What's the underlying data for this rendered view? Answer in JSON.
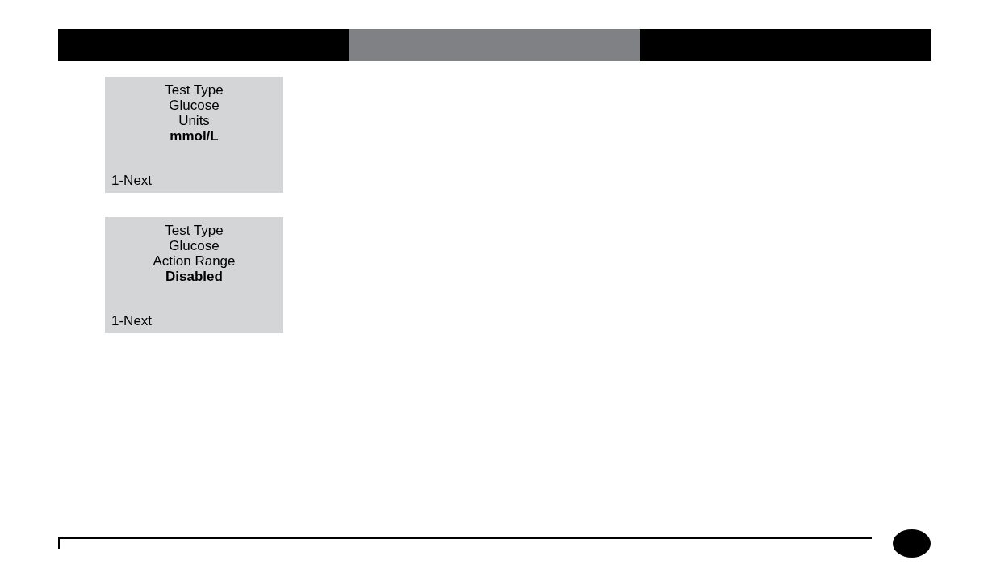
{
  "header": {
    "segments": [
      {
        "selected": false
      },
      {
        "selected": true
      },
      {
        "selected": false
      }
    ]
  },
  "screens": [
    {
      "lines": [
        {
          "kind": "label",
          "text": "Test Type"
        },
        {
          "kind": "label",
          "text": "Glucose"
        },
        {
          "kind": "label",
          "text": "Units"
        },
        {
          "kind": "value",
          "text": "mmol/L"
        }
      ],
      "soft_key": "1-Next"
    },
    {
      "lines": [
        {
          "kind": "label",
          "text": "Test Type"
        },
        {
          "kind": "label",
          "text": "Glucose"
        },
        {
          "kind": "label",
          "text": "Action Range"
        },
        {
          "kind": "value",
          "text": "Disabled"
        }
      ],
      "soft_key": "1-Next"
    }
  ]
}
